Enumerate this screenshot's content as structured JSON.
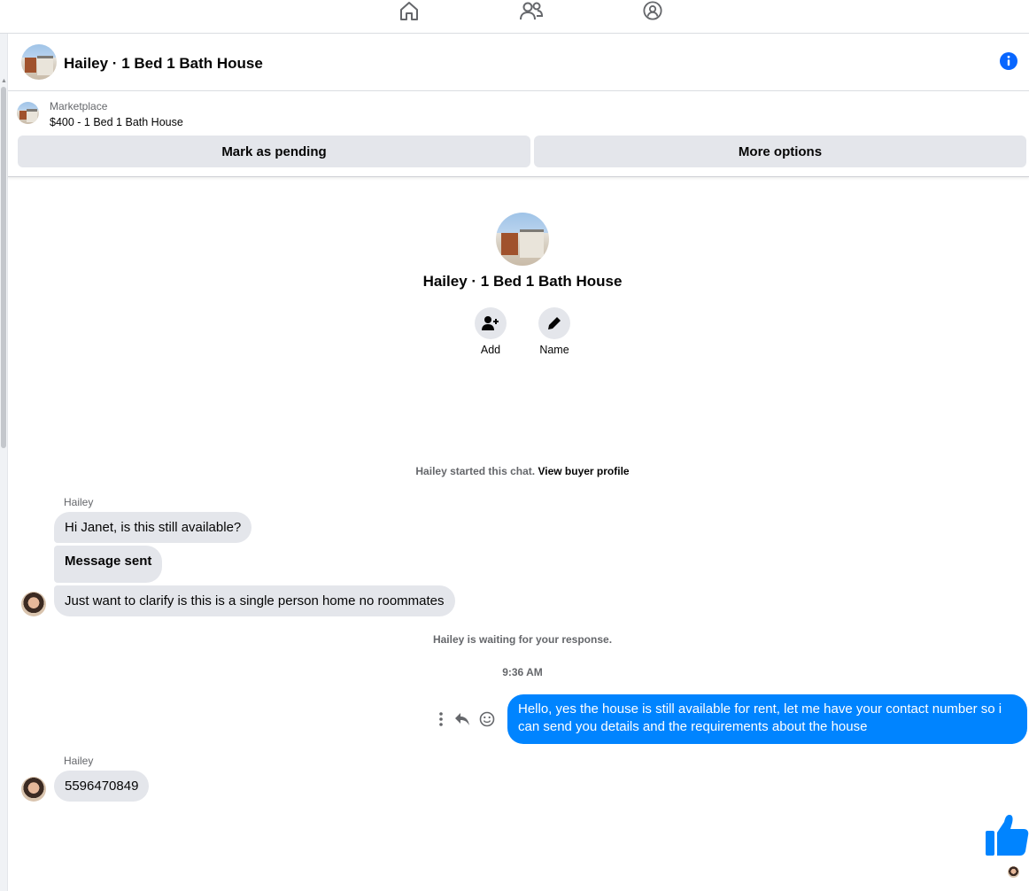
{
  "nav": {
    "items": [
      {
        "icon": "home-icon"
      },
      {
        "icon": "friends-icon"
      },
      {
        "icon": "groups-icon"
      }
    ]
  },
  "header": {
    "title": "Hailey · 1 Bed 1 Bath House",
    "info_icon": "info-icon",
    "accent": "#0866ff"
  },
  "marketplace": {
    "label": "Marketplace",
    "listing": "$400 - 1 Bed 1 Bath House",
    "pending_button": "Mark as pending",
    "more_button": "More options"
  },
  "profile": {
    "name": "Hailey · 1 Bed 1 Bath House",
    "actions": [
      {
        "label": "Add",
        "icon": "add-person-icon"
      },
      {
        "label": "Name",
        "icon": "pencil-icon"
      }
    ]
  },
  "chat": {
    "started_prefix": "Hailey started this chat.",
    "started_link": "View buyer profile",
    "group1_sender": "Hailey",
    "group1_messages": [
      "Hi Janet, is this still available?",
      "Message sent",
      "Just want to clarify is this is a single person home no roommates"
    ],
    "waiting": "Hailey is waiting for your response.",
    "timestamp": "9:36 AM",
    "outgoing": "Hello, yes the house is still available for rent, let me have your contact number so i can send you details and the requirements about the house",
    "outgoing_color": "#0084ff",
    "tools": [
      "more-icon",
      "reply-icon",
      "react-icon"
    ],
    "group2_sender": "Hailey",
    "group2_messages": [
      "5596470849"
    ],
    "like_icon": "thumbs-up-icon"
  }
}
